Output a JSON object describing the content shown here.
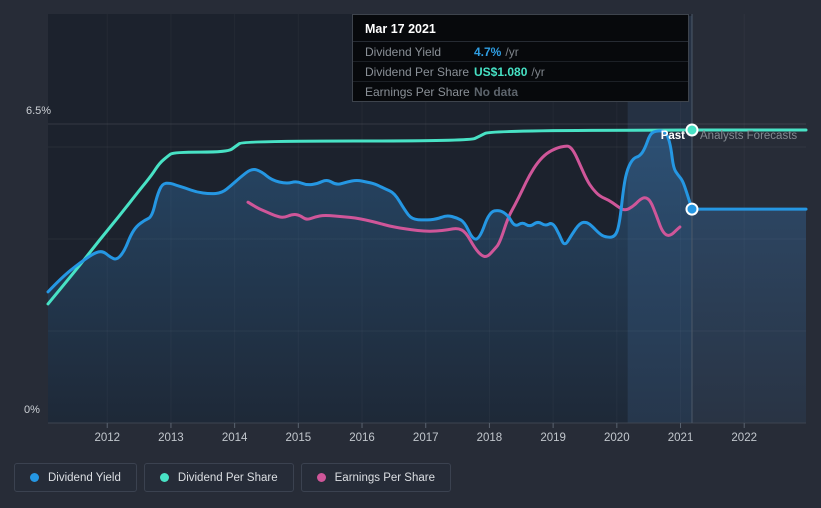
{
  "tooltip": {
    "date": "Mar 17 2021",
    "rows": [
      {
        "label": "Dividend Yield",
        "value": "4.7%",
        "unit": "/yr",
        "color": "#2f9ee3"
      },
      {
        "label": "Dividend Per Share",
        "value": "US$1.080",
        "unit": "/yr",
        "color": "#46e1c4"
      },
      {
        "label": "Earnings Per Share",
        "value": "No data",
        "unit": "",
        "color": "#5d646c"
      }
    ]
  },
  "annotations": {
    "past": "Past",
    "forecast": "Analysts Forecasts"
  },
  "axis": {
    "y_top_label": "6.5%",
    "y_bottom_label": "0%",
    "years": [
      "2012",
      "2013",
      "2014",
      "2015",
      "2016",
      "2017",
      "2018",
      "2019",
      "2020",
      "2021",
      "2022"
    ]
  },
  "legend": [
    {
      "label": "Dividend Yield",
      "color": "#2597e3"
    },
    {
      "label": "Dividend Per Share",
      "color": "#48e2c5"
    },
    {
      "label": "Earnings Per Share",
      "color": "#cf5699"
    }
  ],
  "chart_data": {
    "type": "line",
    "title": "Dividend Yield vs Dividend Per Share vs Earnings Per Share",
    "x_range": [
      2011.07,
      2022.97
    ],
    "y_range_pct": [
      0,
      6.5
    ],
    "gridlines_pct": [
      6.5,
      6.0,
      4.0,
      2.0
    ],
    "year_ticks": [
      2012,
      2013,
      2014,
      2015,
      2016,
      2017,
      2018,
      2019,
      2020,
      2021,
      2022
    ],
    "divider_year": 2021.18,
    "band": [
      2020.17,
      2021.18
    ],
    "legend_position": "bottom",
    "series": [
      {
        "name": "Dividend Yield",
        "color": "#2597e3",
        "fill": true,
        "points": [
          [
            2011.07,
            2.85
          ],
          [
            2011.29,
            3.17
          ],
          [
            2011.57,
            3.48
          ],
          [
            2011.8,
            3.7
          ],
          [
            2011.93,
            3.74
          ],
          [
            2012.04,
            3.61
          ],
          [
            2012.15,
            3.54
          ],
          [
            2012.27,
            3.74
          ],
          [
            2012.37,
            4.09
          ],
          [
            2012.46,
            4.28
          ],
          [
            2012.59,
            4.41
          ],
          [
            2012.7,
            4.48
          ],
          [
            2012.78,
            4.93
          ],
          [
            2012.86,
            5.2
          ],
          [
            2012.98,
            5.22
          ],
          [
            2013.08,
            5.17
          ],
          [
            2013.22,
            5.11
          ],
          [
            2013.4,
            5.02
          ],
          [
            2013.61,
            4.98
          ],
          [
            2013.8,
            5.0
          ],
          [
            2013.95,
            5.17
          ],
          [
            2014.08,
            5.33
          ],
          [
            2014.27,
            5.54
          ],
          [
            2014.43,
            5.46
          ],
          [
            2014.58,
            5.28
          ],
          [
            2014.82,
            5.2
          ],
          [
            2014.97,
            5.26
          ],
          [
            2015.13,
            5.17
          ],
          [
            2015.3,
            5.2
          ],
          [
            2015.45,
            5.3
          ],
          [
            2015.6,
            5.17
          ],
          [
            2015.76,
            5.24
          ],
          [
            2015.92,
            5.28
          ],
          [
            2016.07,
            5.24
          ],
          [
            2016.2,
            5.2
          ],
          [
            2016.36,
            5.09
          ],
          [
            2016.51,
            5.0
          ],
          [
            2016.67,
            4.63
          ],
          [
            2016.78,
            4.43
          ],
          [
            2016.98,
            4.41
          ],
          [
            2017.17,
            4.43
          ],
          [
            2017.33,
            4.52
          ],
          [
            2017.49,
            4.46
          ],
          [
            2017.61,
            4.37
          ],
          [
            2017.74,
            3.98
          ],
          [
            2017.85,
            4.02
          ],
          [
            2018.0,
            4.59
          ],
          [
            2018.16,
            4.63
          ],
          [
            2018.29,
            4.52
          ],
          [
            2018.4,
            4.26
          ],
          [
            2018.52,
            4.37
          ],
          [
            2018.63,
            4.26
          ],
          [
            2018.76,
            4.39
          ],
          [
            2018.88,
            4.28
          ],
          [
            2018.99,
            4.37
          ],
          [
            2019.1,
            4.09
          ],
          [
            2019.18,
            3.83
          ],
          [
            2019.29,
            4.09
          ],
          [
            2019.42,
            4.35
          ],
          [
            2019.53,
            4.37
          ],
          [
            2019.61,
            4.28
          ],
          [
            2019.73,
            4.11
          ],
          [
            2019.82,
            4.04
          ],
          [
            2019.97,
            4.04
          ],
          [
            2020.04,
            4.3
          ],
          [
            2020.11,
            5.17
          ],
          [
            2020.17,
            5.54
          ],
          [
            2020.26,
            5.76
          ],
          [
            2020.36,
            5.8
          ],
          [
            2020.44,
            5.96
          ],
          [
            2020.52,
            6.28
          ],
          [
            2020.61,
            6.35
          ],
          [
            2020.74,
            6.35
          ],
          [
            2020.8,
            6.24
          ],
          [
            2020.85,
            5.98
          ],
          [
            2020.89,
            5.54
          ],
          [
            2020.96,
            5.39
          ],
          [
            2021.03,
            5.28
          ],
          [
            2021.1,
            5.0
          ],
          [
            2021.18,
            4.65
          ]
        ],
        "forecast": [
          [
            2021.18,
            4.65
          ],
          [
            2022.97,
            4.65
          ]
        ]
      },
      {
        "name": "Dividend Per Share",
        "color": "#48e2c5",
        "fill": false,
        "points": [
          [
            2011.07,
            2.59
          ],
          [
            2011.25,
            2.89
          ],
          [
            2011.57,
            3.43
          ],
          [
            2011.88,
            3.98
          ],
          [
            2012.2,
            4.52
          ],
          [
            2012.51,
            5.07
          ],
          [
            2012.7,
            5.39
          ],
          [
            2012.82,
            5.65
          ],
          [
            2012.95,
            5.8
          ],
          [
            2013.04,
            5.89
          ],
          [
            2013.89,
            5.89
          ],
          [
            2014.02,
            6.02
          ],
          [
            2014.13,
            6.13
          ],
          [
            2017.69,
            6.13
          ],
          [
            2017.85,
            6.24
          ],
          [
            2018.01,
            6.35
          ],
          [
            2021.18,
            6.37
          ]
        ],
        "forecast": [
          [
            2021.18,
            6.37
          ],
          [
            2022.97,
            6.37
          ]
        ]
      },
      {
        "name": "Earnings Per Share",
        "color": "#cf5699",
        "fill": false,
        "points": [
          [
            2014.21,
            4.8
          ],
          [
            2014.36,
            4.67
          ],
          [
            2014.5,
            4.59
          ],
          [
            2014.64,
            4.5
          ],
          [
            2014.77,
            4.46
          ],
          [
            2014.91,
            4.54
          ],
          [
            2015.02,
            4.52
          ],
          [
            2015.13,
            4.41
          ],
          [
            2015.26,
            4.48
          ],
          [
            2015.41,
            4.52
          ],
          [
            2015.73,
            4.48
          ],
          [
            2015.89,
            4.46
          ],
          [
            2016.07,
            4.41
          ],
          [
            2016.25,
            4.35
          ],
          [
            2016.43,
            4.28
          ],
          [
            2016.59,
            4.24
          ],
          [
            2016.78,
            4.2
          ],
          [
            2016.97,
            4.17
          ],
          [
            2017.16,
            4.17
          ],
          [
            2017.35,
            4.2
          ],
          [
            2017.5,
            4.24
          ],
          [
            2017.63,
            4.15
          ],
          [
            2017.77,
            3.8
          ],
          [
            2017.88,
            3.63
          ],
          [
            2017.97,
            3.61
          ],
          [
            2018.08,
            3.78
          ],
          [
            2018.16,
            3.91
          ],
          [
            2018.29,
            4.46
          ],
          [
            2018.4,
            4.74
          ],
          [
            2018.52,
            5.07
          ],
          [
            2018.63,
            5.39
          ],
          [
            2018.76,
            5.67
          ],
          [
            2018.9,
            5.87
          ],
          [
            2019.06,
            5.98
          ],
          [
            2019.18,
            6.02
          ],
          [
            2019.26,
            6.02
          ],
          [
            2019.34,
            5.87
          ],
          [
            2019.43,
            5.59
          ],
          [
            2019.53,
            5.28
          ],
          [
            2019.62,
            5.09
          ],
          [
            2019.73,
            4.93
          ],
          [
            2019.87,
            4.85
          ],
          [
            2020.0,
            4.72
          ],
          [
            2020.12,
            4.61
          ],
          [
            2020.25,
            4.7
          ],
          [
            2020.37,
            4.87
          ],
          [
            2020.45,
            4.91
          ],
          [
            2020.53,
            4.83
          ],
          [
            2020.62,
            4.52
          ],
          [
            2020.7,
            4.2
          ],
          [
            2020.78,
            4.07
          ],
          [
            2020.86,
            4.09
          ],
          [
            2020.94,
            4.2
          ],
          [
            2020.99,
            4.26
          ]
        ],
        "forecast": []
      }
    ],
    "markers": [
      {
        "series": "Dividend Per Share",
        "year": 2021.18,
        "pct": 6.37,
        "color": "#48e2c5"
      },
      {
        "series": "Dividend Yield",
        "year": 2021.18,
        "pct": 4.65,
        "color": "#2597e3"
      }
    ]
  }
}
